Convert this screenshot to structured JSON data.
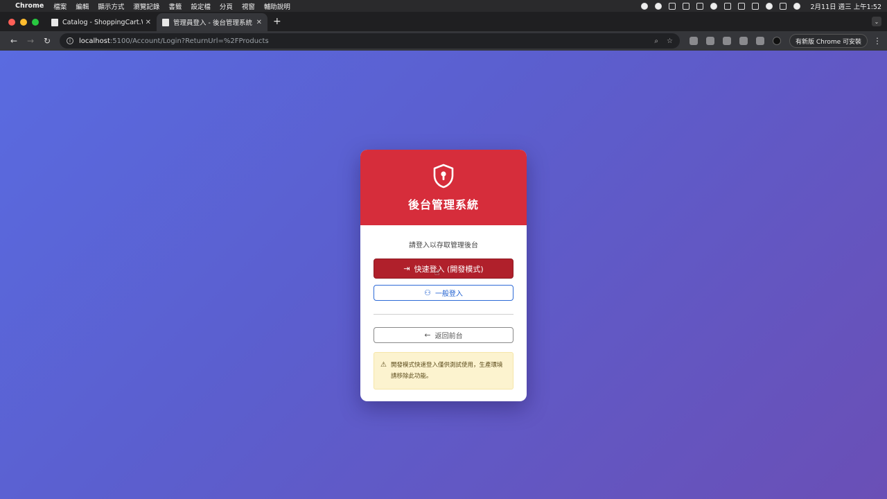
{
  "menubar": {
    "app_name": "Chrome",
    "items": [
      "檔案",
      "編輯",
      "顯示方式",
      "瀏覽記錄",
      "書籤",
      "設定檔",
      "分頁",
      "視窗",
      "輔助說明"
    ],
    "clock": "2月11日 週三 上午1:52"
  },
  "tabs": [
    {
      "title": "Catalog - ShoppingCart.Web"
    },
    {
      "title": "管理員登入 - 後台管理系統"
    }
  ],
  "address": {
    "host": "localhost",
    "path": ":5100/Account/Login?ReturnUrl=%2FProducts"
  },
  "browser": {
    "update_label": "有新版 Chrome 可安裝"
  },
  "login": {
    "title": "後台管理系統",
    "subtitle": "請登入以存取管理後台",
    "quick_login": "快速登入 (開發模式)",
    "normal_login": "一般登入",
    "back": "返回前台",
    "warning": "開發模式快速登入僅供測試使用，生產環境請移除此功能。"
  },
  "colors": {
    "header_red": "#d62d3b",
    "quick_button": "#b0202b",
    "normal_button_border": "#2d6ad6",
    "warning_bg": "#fcf3cf"
  }
}
